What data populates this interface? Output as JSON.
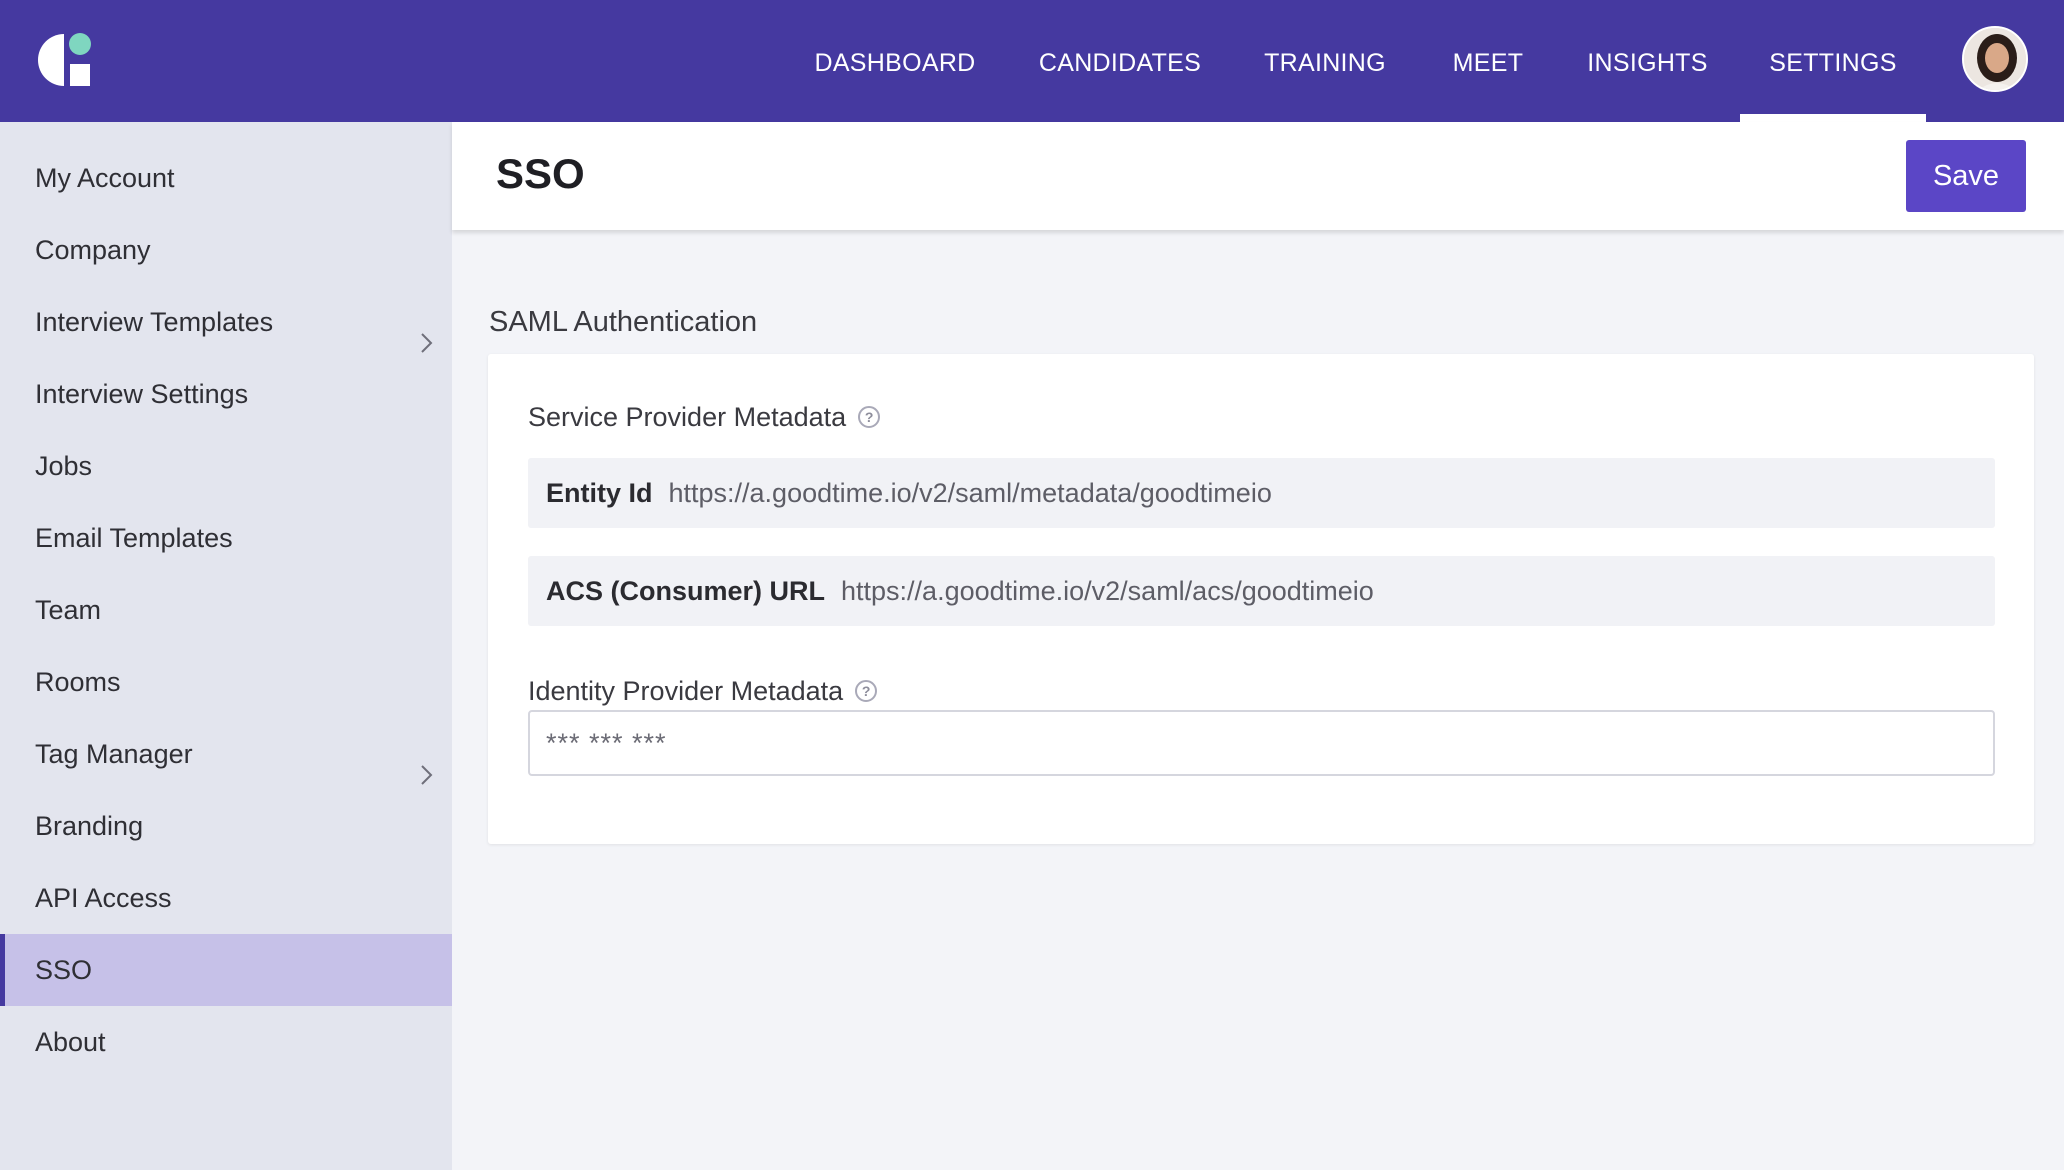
{
  "nav": {
    "items": [
      {
        "label": "DASHBOARD"
      },
      {
        "label": "CANDIDATES"
      },
      {
        "label": "TRAINING"
      },
      {
        "label": "MEET"
      },
      {
        "label": "INSIGHTS"
      },
      {
        "label": "SETTINGS",
        "active": true
      }
    ]
  },
  "sidebar": {
    "items": [
      {
        "label": "My Account"
      },
      {
        "label": "Company"
      },
      {
        "label": "Interview Templates",
        "has_chevron": true
      },
      {
        "label": "Interview Settings"
      },
      {
        "label": "Jobs"
      },
      {
        "label": "Email Templates"
      },
      {
        "label": "Team"
      },
      {
        "label": "Rooms"
      },
      {
        "label": "Tag Manager",
        "has_chevron": true
      },
      {
        "label": "Branding"
      },
      {
        "label": "API Access"
      },
      {
        "label": "SSO",
        "active": true
      },
      {
        "label": "About"
      }
    ]
  },
  "header": {
    "title": "SSO",
    "save_label": "Save"
  },
  "section": {
    "title": "SAML Authentication"
  },
  "card": {
    "sp_label": "Service Provider Metadata",
    "help_glyph": "?",
    "entity_key": "Entity Id",
    "entity_value": "https://a.goodtime.io/v2/saml/metadata/goodtimeio",
    "acs_key": "ACS (Consumer) URL",
    "acs_value": "https://a.goodtime.io/v2/saml/acs/goodtimeio",
    "idp_label": "Identity Provider Metadata",
    "idp_placeholder": "*** *** ***"
  },
  "colors": {
    "brand": "#4539a0",
    "accent": "#5b46c6",
    "sidebar_active": "#c6c1e8",
    "logo_dot": "#7fd6c0"
  },
  "icons": {
    "logo": "goodtime-logo",
    "help": "help-circle-icon",
    "chevron": "chevron-right-icon",
    "avatar": "user-avatar"
  }
}
